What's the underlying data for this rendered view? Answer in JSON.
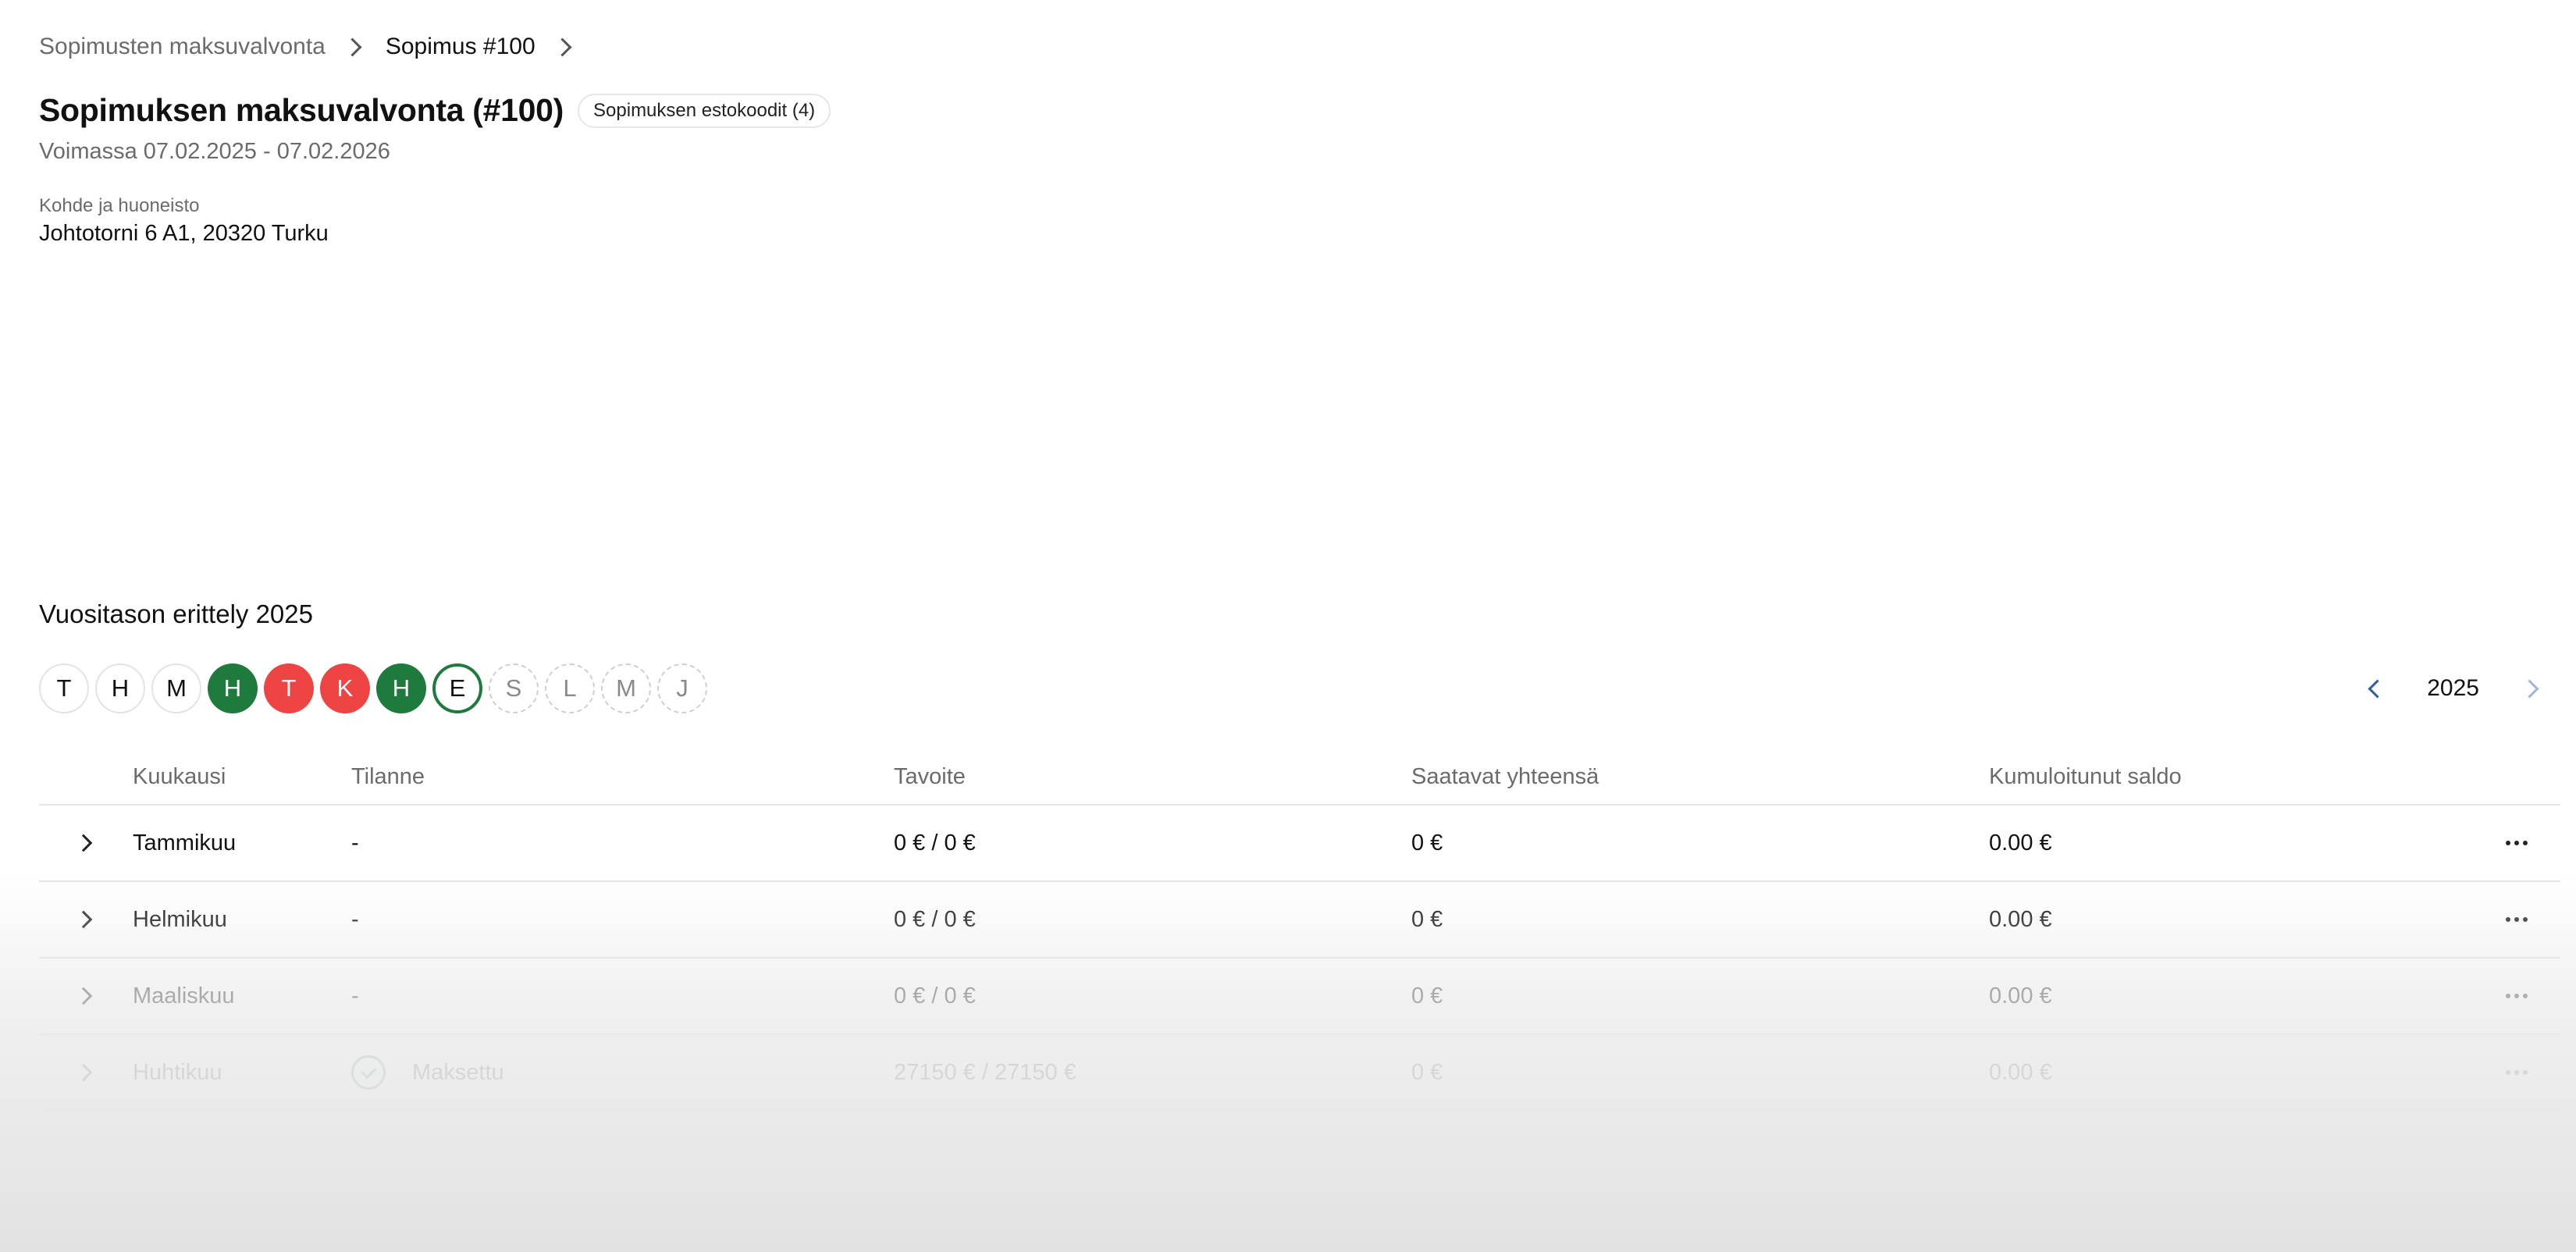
{
  "breadcrumb": {
    "items": [
      {
        "label": "Sopimusten maksuvalvonta"
      },
      {
        "label": "Sopimus #100"
      }
    ]
  },
  "header": {
    "title": "Sopimuksen maksuvalvonta (#100)",
    "chip_label": "Sopimuksen estokoodit (4)",
    "validity": "Voimassa 07.02.2025 - 07.02.2026",
    "property_label": "Kohde ja huoneisto",
    "property_value": "Johtotorni 6 A1, 20320 Turku"
  },
  "year_section": {
    "title": "Vuositason erittely 2025",
    "year": "2025",
    "months": [
      {
        "letter": "T",
        "state": "plain"
      },
      {
        "letter": "H",
        "state": "plain"
      },
      {
        "letter": "M",
        "state": "plain"
      },
      {
        "letter": "H",
        "state": "paid"
      },
      {
        "letter": "T",
        "state": "late"
      },
      {
        "letter": "K",
        "state": "late"
      },
      {
        "letter": "H",
        "state": "paid"
      },
      {
        "letter": "E",
        "state": "current"
      },
      {
        "letter": "S",
        "state": "future"
      },
      {
        "letter": "L",
        "state": "future"
      },
      {
        "letter": "M",
        "state": "future"
      },
      {
        "letter": "J",
        "state": "future"
      }
    ],
    "colors": {
      "paid": "#1f7a3d",
      "late": "#ef4444"
    }
  },
  "table": {
    "headers": {
      "month": "Kuukausi",
      "status": "Tilanne",
      "target": "Tavoite",
      "due": "Saatavat yhteensä",
      "balance": "Kumuloitunut saldo"
    },
    "rows": [
      {
        "month": "Tammikuu",
        "status": "-",
        "target": "0 € / 0 €",
        "due": "0 €",
        "balance": "0.00 €"
      },
      {
        "month": "Helmikuu",
        "status": "-",
        "target": "0 € / 0 €",
        "due": "0 €",
        "balance": "0.00 €"
      },
      {
        "month": "Maaliskuu",
        "status": "-",
        "target": "0 € / 0 €",
        "due": "0 €",
        "balance": "0.00 €"
      },
      {
        "month": "Huhtikuu",
        "status": "Maksettu",
        "status_icon": "check-circle-icon",
        "target": "27150 € / 27150 €",
        "due": "0 €",
        "balance": "0.00 €"
      }
    ]
  }
}
